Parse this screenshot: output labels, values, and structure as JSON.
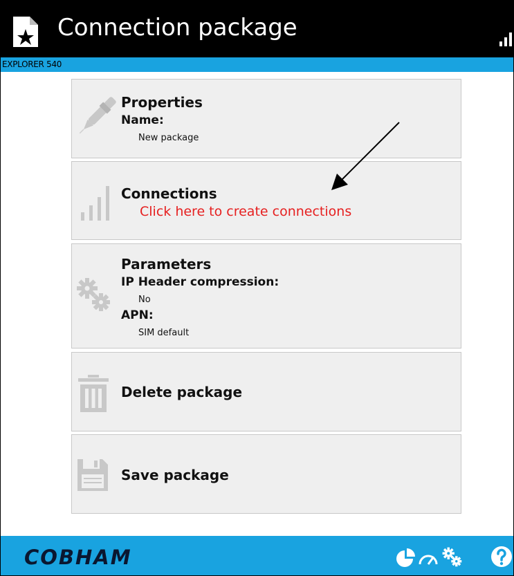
{
  "header": {
    "title": "Connection package",
    "device": "EXPLORER 540",
    "accent_color": "#19a3e0"
  },
  "cards": {
    "properties": {
      "heading": "Properties",
      "name_label": "Name:",
      "name_value": "New package",
      "icon": "pen-icon"
    },
    "connections": {
      "heading": "Connections",
      "link": "Click here to create connections",
      "link_color": "#e62020",
      "icon": "signal-bars-icon"
    },
    "parameters": {
      "heading": "Parameters",
      "ip_label": "IP Header compression:",
      "ip_value": "No",
      "apn_label": "APN:",
      "apn_value": "SIM default",
      "icon": "gears-icon"
    },
    "delete": {
      "label": "Delete package",
      "icon": "trash-icon"
    },
    "save": {
      "label": "Save package",
      "icon": "floppy-disk-icon"
    }
  },
  "footer": {
    "brand": "COBHAM",
    "icons": [
      "pie-chart-icon",
      "speedometer-icon",
      "gears-icon",
      "help-icon"
    ]
  }
}
